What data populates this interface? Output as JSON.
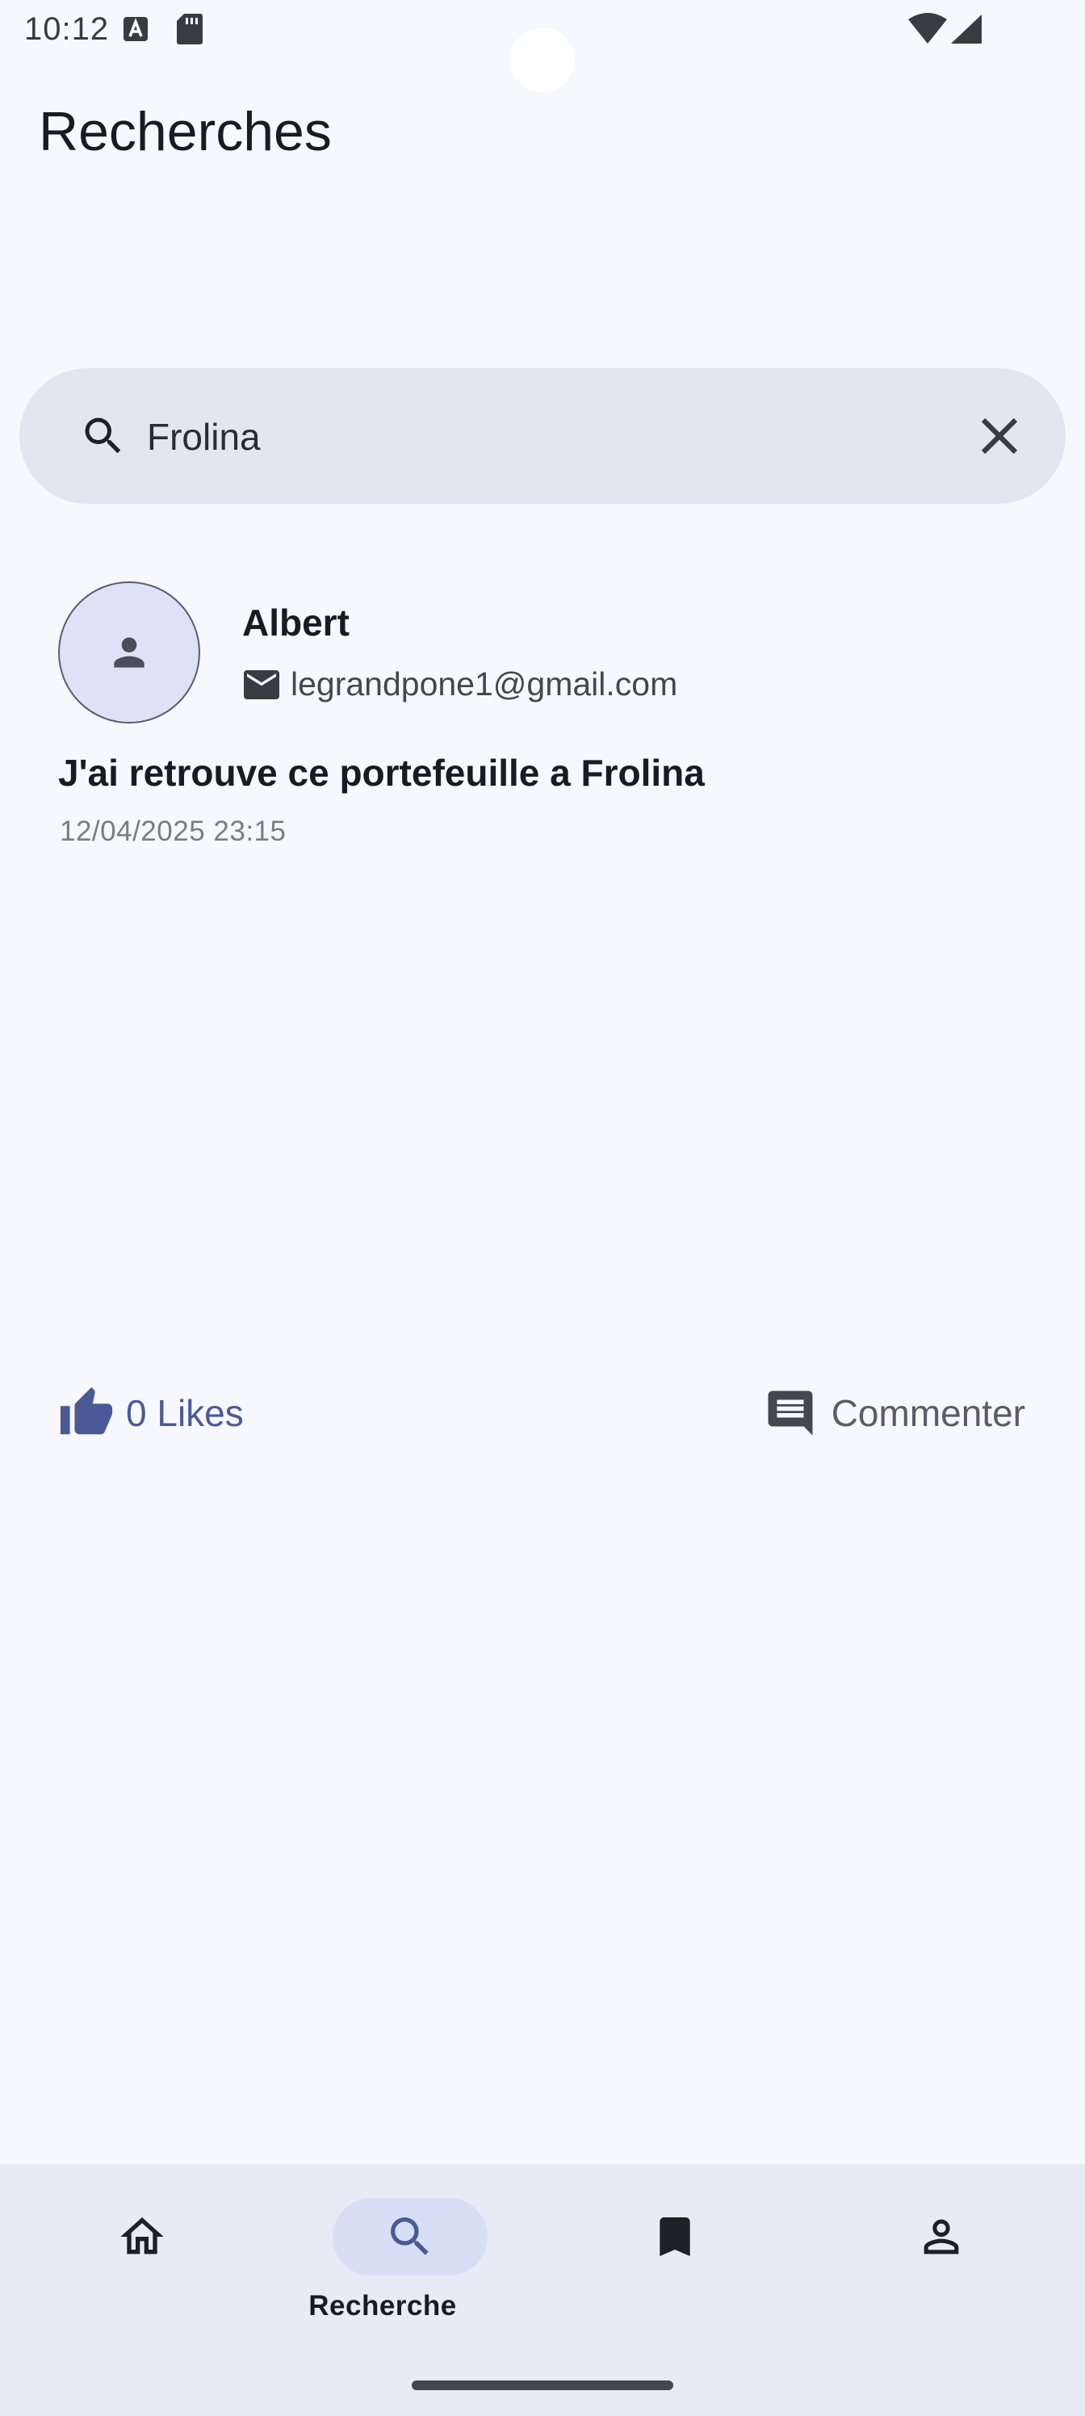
{
  "status_bar": {
    "time": "10:12",
    "icons": [
      "text-a-icon",
      "sd-card-icon",
      "wifi-icon",
      "cell-signal-icon"
    ]
  },
  "page": {
    "title": "Recherches"
  },
  "search": {
    "value": "Frolina",
    "placeholder": "",
    "icons": [
      "search-icon",
      "close-icon"
    ]
  },
  "post": {
    "author_name": "Albert",
    "author_email": "legrandpone1@gmail.com",
    "title": "J'ai retrouve ce portefeuille a Frolina",
    "date": "12/04/2025 23:15",
    "likes_label": "0 Likes",
    "comment_label": "Commenter"
  },
  "nav": {
    "items": [
      {
        "icon": "home-icon",
        "label": ""
      },
      {
        "icon": "search-icon",
        "label": "Recherche",
        "selected": true
      },
      {
        "icon": "bookmark-icon",
        "label": ""
      },
      {
        "icon": "profile-icon",
        "label": ""
      }
    ]
  },
  "colors": {
    "background": "#f7f8fd",
    "search_bar": "#e3e5f0",
    "accent": "#4a5a96",
    "nav_background": "#e8eaf5",
    "nav_pill": "#d8def5",
    "avatar_background": "#dde2f6"
  }
}
